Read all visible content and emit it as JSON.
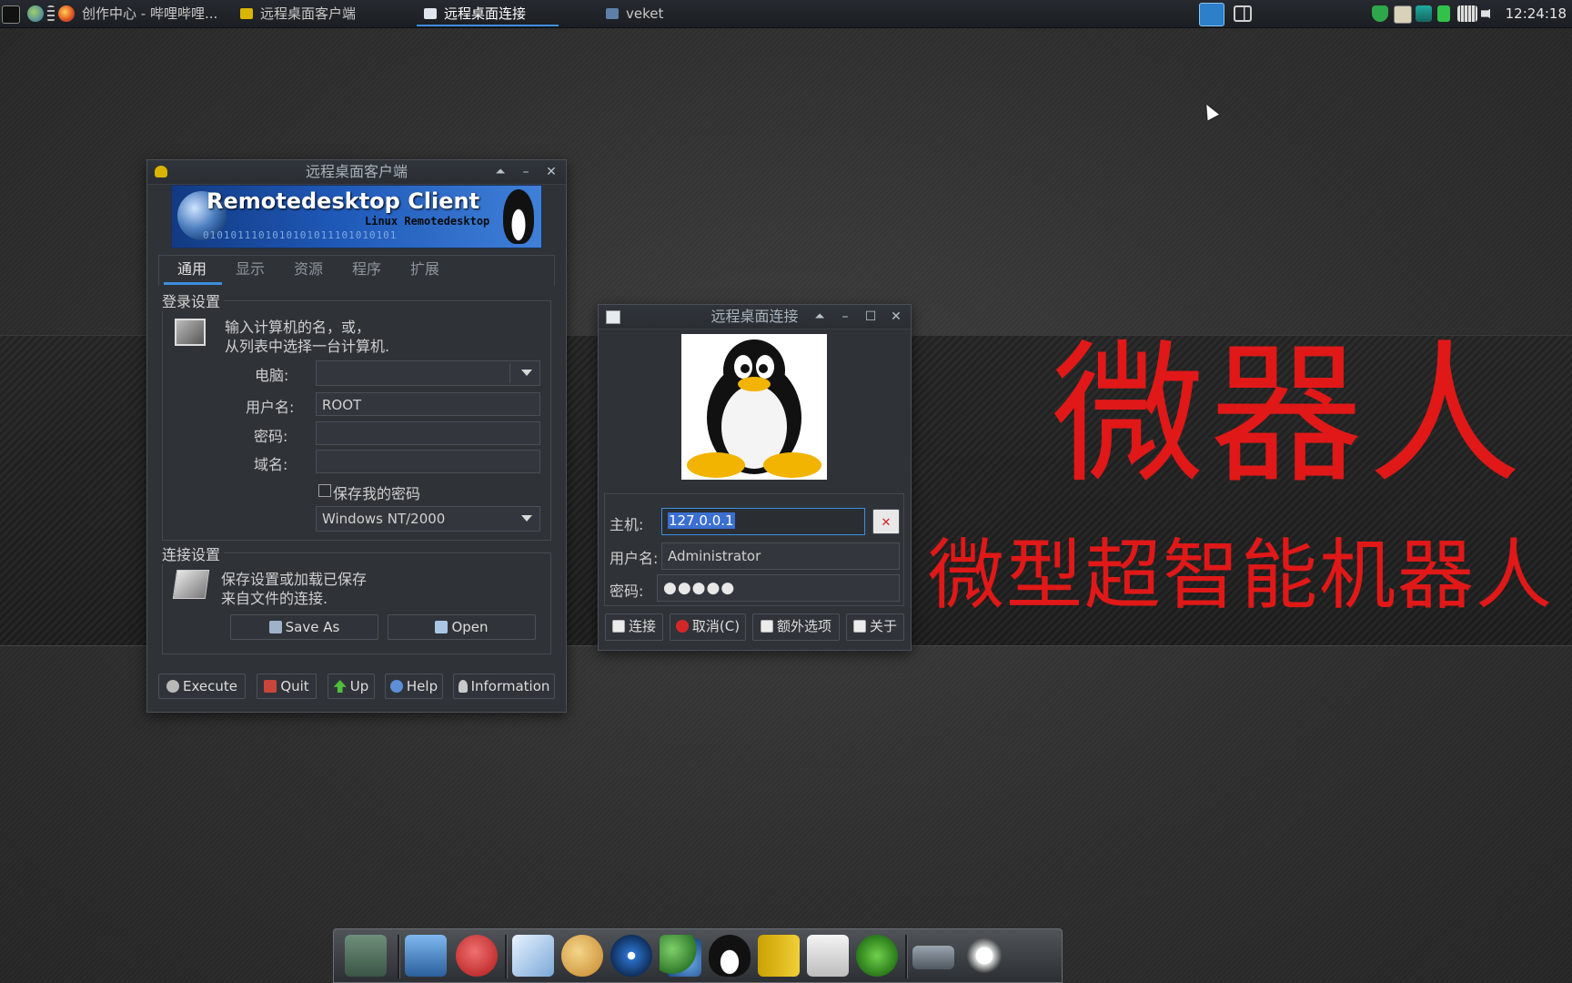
{
  "taskbar": {
    "tasks": [
      {
        "label": "创作中心 - 哔哩哔哩..."
      },
      {
        "label": "远程桌面客户端"
      },
      {
        "label": "远程桌面连接"
      },
      {
        "label": "veket"
      }
    ],
    "clock": "12:24:18"
  },
  "client_window": {
    "title": "远程桌面客户端",
    "banner_title": "Remotedesktop Client",
    "banner_subtitle": "Linux Remotedesktop",
    "banner_bits": "0101011101010101011101010101",
    "tabs": [
      "通用",
      "显示",
      "资源",
      "程序",
      "扩展"
    ],
    "login_group": "登录设置",
    "login_hint_1": "输入计算机的名，或，",
    "login_hint_2": "从列表中选择一台计算机.",
    "computer_label": "电脑:",
    "computer_value": "",
    "username_label": "用户名:",
    "username_value": "ROOT",
    "password_label": "密码:",
    "password_value": "",
    "domain_label": "域名:",
    "domain_value": "",
    "save_password_label": "保存我的密码",
    "save_password_checked": false,
    "os_select": "Windows NT/2000",
    "connection_group": "连接设置",
    "connection_hint_1": "保存设置或加载已保存",
    "connection_hint_2": "来自文件的连接.",
    "save_as": "Save As",
    "open": "Open",
    "buttons": [
      "Execute",
      "Quit",
      "Up",
      "Help",
      "Information"
    ]
  },
  "connect_window": {
    "title": "远程桌面连接",
    "host_label": "主机:",
    "host_value": "127.0.0.1",
    "username_label": "用户名:",
    "username_value": "Administrator",
    "password_label": "密码:",
    "password_value": "●●●●●",
    "buttons": [
      "连接",
      "取消(C)",
      "额外选项",
      "关于"
    ]
  },
  "wallpaper": {
    "title_big": "微器人",
    "subtitle_big": "微型超智能机器人"
  },
  "colors": {
    "accent": "#3d8ee0",
    "wallpaper_text": "#e01818",
    "window_bg": "#2f3338",
    "selection": "#3b6fd0"
  }
}
